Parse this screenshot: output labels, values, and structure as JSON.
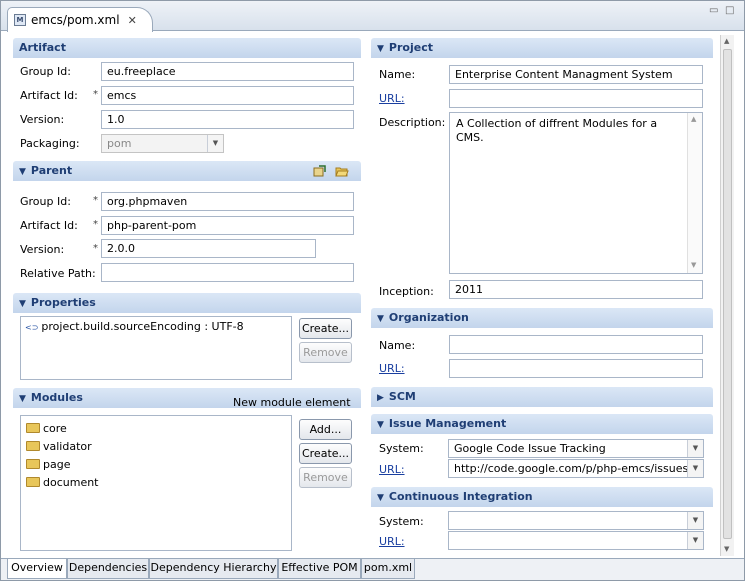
{
  "editor_tab": {
    "icon": "M",
    "title": "emcs/pom.xml",
    "close": "✕"
  },
  "window_controls": {
    "minimize": "▭",
    "maximize": "□"
  },
  "artifact": {
    "title": "Artifact",
    "group_id_label": "Group Id:",
    "group_id": "eu.freeplace",
    "artifact_id_label": "Artifact Id:",
    "artifact_id": "emcs",
    "version_label": "Version:",
    "version": "1.0",
    "packaging_label": "Packaging:",
    "packaging": "pom"
  },
  "parent": {
    "title": "Parent",
    "group_id_label": "Group Id:",
    "group_id": "org.phpmaven",
    "artifact_id_label": "Artifact Id:",
    "artifact_id": "php-parent-pom",
    "version_label": "Version:",
    "version": "2.0.0",
    "relative_path_label": "Relative Path:",
    "relative_path": ""
  },
  "properties": {
    "title": "Properties",
    "items": [
      "project.build.sourceEncoding : UTF-8"
    ],
    "create_label": "Create...",
    "remove_label": "Remove"
  },
  "modules": {
    "title": "Modules",
    "new_element": "New module element",
    "items": [
      "core",
      "validator",
      "page",
      "document"
    ],
    "add_label": "Add...",
    "create_label": "Create...",
    "remove_label": "Remove"
  },
  "project": {
    "title": "Project",
    "name_label": "Name:",
    "name": "Enterprise Content Managment System",
    "url_label": "URL:",
    "url": "",
    "description_label": "Description:",
    "description": "A Collection of diffrent Modules for a CMS.",
    "inception_label": "Inception:",
    "inception": "2011"
  },
  "organization": {
    "title": "Organization",
    "name_label": "Name:",
    "name": "",
    "url_label": "URL:",
    "url": ""
  },
  "scm": {
    "title": "SCM"
  },
  "issue_management": {
    "title": "Issue Management",
    "system_label": "System:",
    "system": "Google Code Issue Tracking",
    "url_label": "URL:",
    "url": "http://code.google.com/p/php-emcs/issues"
  },
  "ci": {
    "title": "Continuous Integration",
    "system_label": "System:",
    "system": "",
    "url_label": "URL:",
    "url": ""
  },
  "bottom_tabs": [
    "Overview",
    "Dependencies",
    "Dependency Hierarchy",
    "Effective POM",
    "pom.xml"
  ],
  "colors": {
    "section_header": "#c3d5ec",
    "section_text": "#1f3e74",
    "link": "#1a3fa0"
  }
}
